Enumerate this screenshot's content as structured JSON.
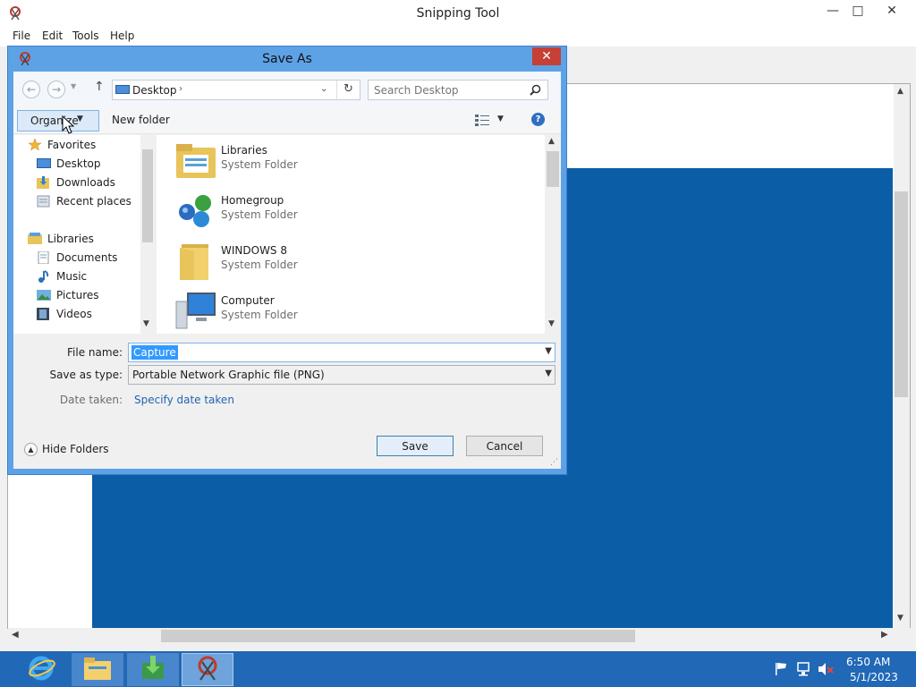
{
  "window": {
    "title": "Snipping Tool",
    "menu": [
      "File",
      "Edit",
      "Tools",
      "Help"
    ],
    "controls": {
      "minimize": "—",
      "maximize": "□",
      "close": "✕"
    }
  },
  "dialog": {
    "title": "Save As",
    "close": "✕",
    "address": "Desktop",
    "search_placeholder": "Search Desktop",
    "organize_label": "Organize",
    "new_folder_label": "New folder",
    "nav_tree": [
      {
        "label": "Favorites",
        "icon": "star-icon",
        "level": 0
      },
      {
        "label": "Desktop",
        "icon": "desktop-icon",
        "level": 1
      },
      {
        "label": "Downloads",
        "icon": "downloads-icon",
        "level": 1
      },
      {
        "label": "Recent places",
        "icon": "recent-places-icon",
        "level": 1
      },
      {
        "label": "Libraries",
        "icon": "libraries-icon",
        "level": 0
      },
      {
        "label": "Documents",
        "icon": "documents-icon",
        "level": 1
      },
      {
        "label": "Music",
        "icon": "music-icon",
        "level": 1
      },
      {
        "label": "Pictures",
        "icon": "pictures-icon",
        "level": 1
      },
      {
        "label": "Videos",
        "icon": "videos-icon",
        "level": 1
      }
    ],
    "files": [
      {
        "name": "Libraries",
        "type": "System Folder",
        "icon": "libraries-folder-icon"
      },
      {
        "name": "Homegroup",
        "type": "System Folder",
        "icon": "homegroup-icon"
      },
      {
        "name": "WINDOWS 8",
        "type": "System Folder",
        "icon": "user-folder-icon"
      },
      {
        "name": "Computer",
        "type": "System Folder",
        "icon": "computer-icon"
      }
    ],
    "file_name_label": "File name:",
    "file_name_value": "Capture",
    "save_type_label": "Save as type:",
    "save_type_value": "Portable Network Graphic file (PNG)",
    "date_taken_label": "Date taken:",
    "date_taken_link": "Specify date taken",
    "hide_folders_label": "Hide Folders",
    "save_label": "Save",
    "cancel_label": "Cancel"
  },
  "taskbar": {
    "apps": [
      "internet-explorer-icon",
      "file-explorer-icon",
      "downloads-app-icon",
      "snipping-tool-icon"
    ],
    "time": "6:50 AM",
    "date": "5/1/2023"
  },
  "colors": {
    "capture_blue": "#0b5ea6",
    "dialog_frame": "#5ea2e6",
    "taskbar": "#2168b6",
    "selection": "#3399ff",
    "link": "#1f64b4"
  }
}
